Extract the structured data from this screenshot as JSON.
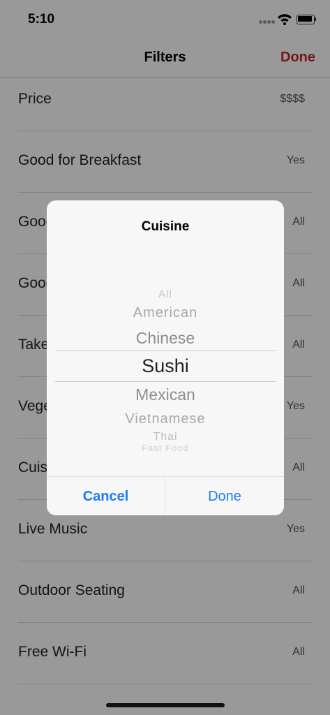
{
  "status_bar": {
    "time": "5:10"
  },
  "nav": {
    "title": "Filters",
    "done_label": "Done"
  },
  "filters": [
    {
      "label": "Price",
      "value": "$$$$"
    },
    {
      "label": "Good for Breakfast",
      "value": "Yes"
    },
    {
      "label": "Good for Lunch",
      "value": "All"
    },
    {
      "label": "Good for Dinner",
      "value": "All"
    },
    {
      "label": "Takeout",
      "value": "All"
    },
    {
      "label": "Vegetarian",
      "value": "Yes"
    },
    {
      "label": "Cuisine",
      "value": "All"
    },
    {
      "label": "Live Music",
      "value": "Yes"
    },
    {
      "label": "Outdoor Seating",
      "value": "All"
    },
    {
      "label": "Free Wi-Fi",
      "value": "All"
    }
  ],
  "dialog": {
    "title": "Cuisine",
    "picker_options": [
      "All",
      "American",
      "Chinese",
      "Sushi",
      "Mexican",
      "Vietnamese",
      "Thai",
      "Fast Food"
    ],
    "selected": "Sushi",
    "cancel_label": "Cancel",
    "done_label": "Done"
  },
  "colors": {
    "accent": "#c0272d",
    "link": "#1a7cf5"
  }
}
